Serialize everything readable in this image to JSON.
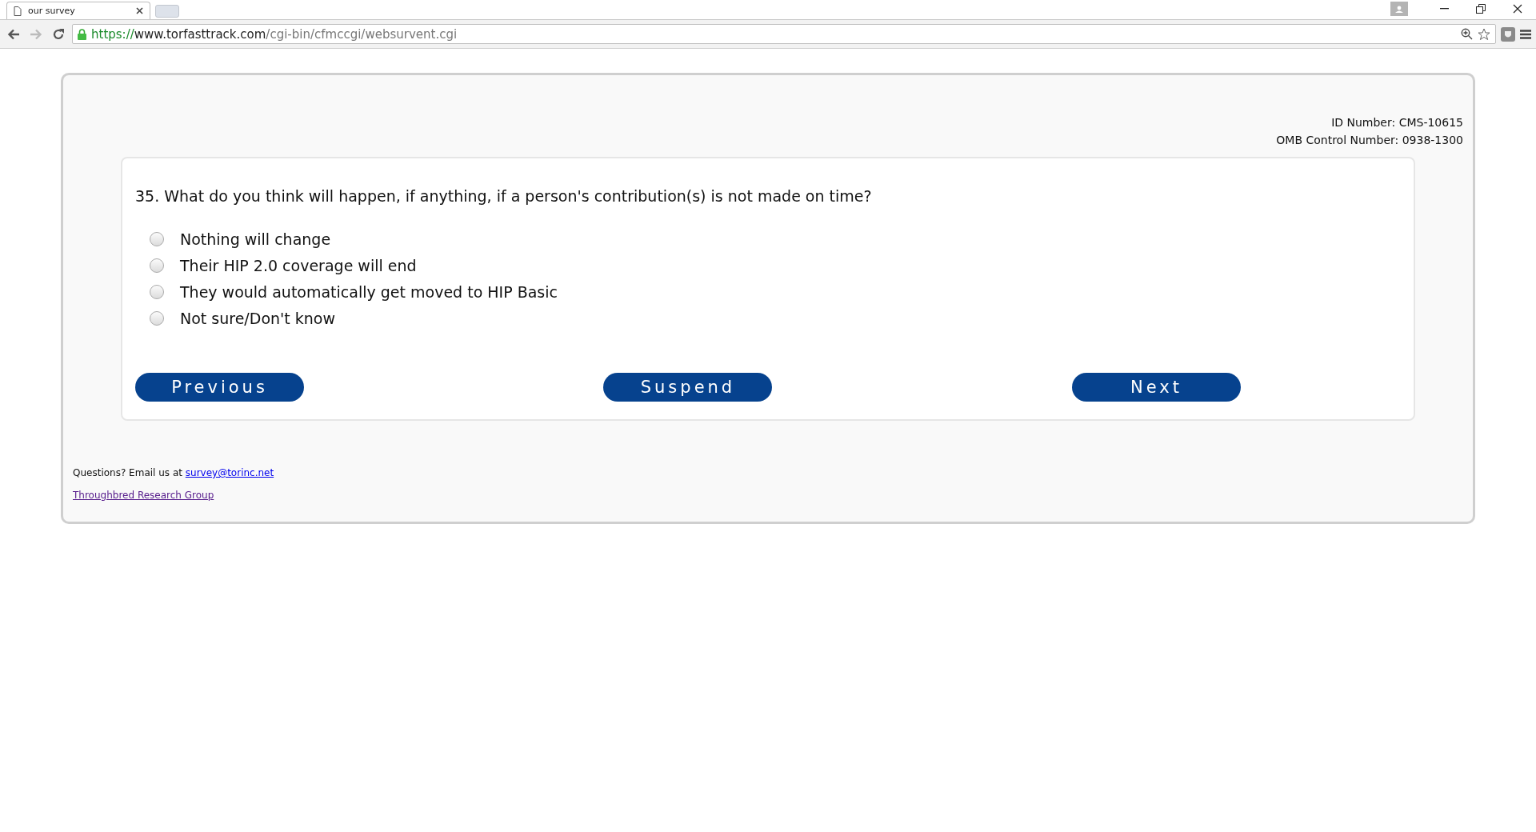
{
  "browser": {
    "tab": {
      "title": "our survey"
    },
    "url": {
      "scheme": "https://",
      "host": "www.torfasttrack.com",
      "path": "/cgi-bin/cfmccgi/websurvent.cgi"
    }
  },
  "ids": [
    "ID Number: CMS-10615",
    "OMB Control Number: 0938-1300"
  ],
  "question": "35. What do you think will happen, if anything, if a person's contribution(s) is not made on time?",
  "options": [
    {
      "label": "Nothing will change",
      "selected": false
    },
    {
      "label": "Their HIP 2.0 coverage will end",
      "selected": false
    },
    {
      "label": "They would automatically get moved to HIP Basic",
      "selected": false
    },
    {
      "label": "Not sure/Don't know",
      "selected": false
    }
  ],
  "buttons": [
    "Previous",
    "Suspend",
    "Next"
  ],
  "footer": {
    "text": "Questions? Email us at",
    "email": "survey@torinc.net",
    "link": "Throughbred Research Group"
  }
}
